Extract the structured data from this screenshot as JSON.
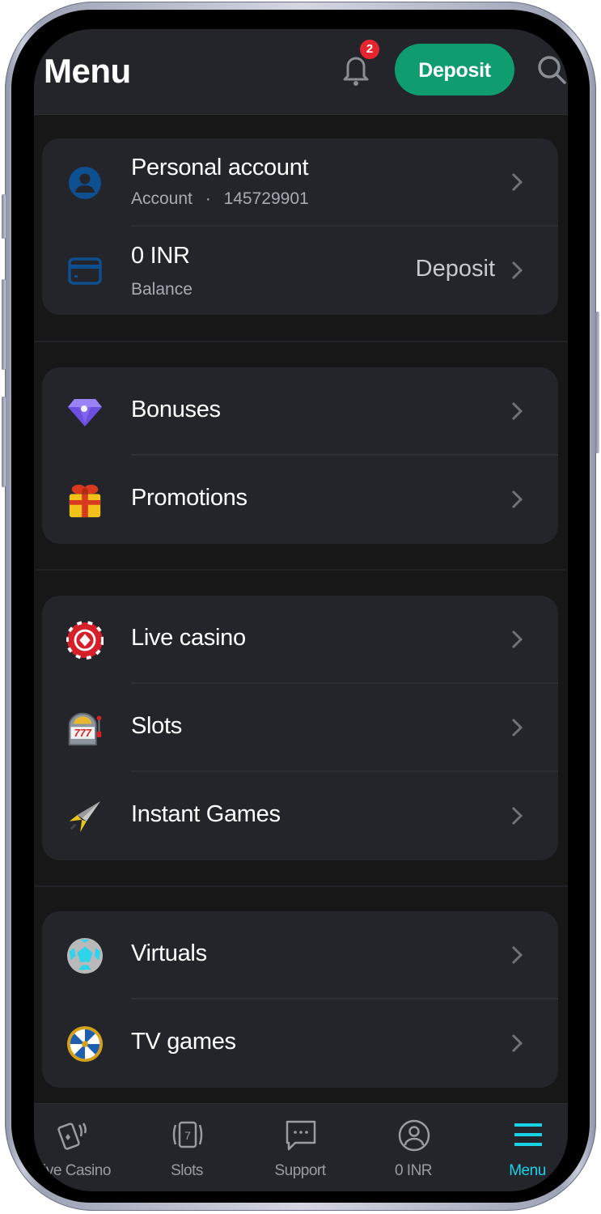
{
  "header": {
    "title": "Menu",
    "notification_count": "2",
    "deposit_label": "Deposit",
    "icons": {
      "notifications": "bell-icon",
      "search": "search-icon"
    }
  },
  "account_card": {
    "personal": {
      "title": "Personal account",
      "sub_label": "Account",
      "separator": "·",
      "account_number": "145729901",
      "icon": "user-circle-icon"
    },
    "balance": {
      "amount": "0 INR",
      "sub_label": "Balance",
      "action_label": "Deposit",
      "icon": "credit-card-icon"
    }
  },
  "sections": [
    {
      "items": [
        {
          "label": "Bonuses",
          "icon": "diamond-icon"
        },
        {
          "label": "Promotions",
          "icon": "gift-icon"
        }
      ]
    },
    {
      "items": [
        {
          "label": "Live casino",
          "icon": "casino-chip-icon"
        },
        {
          "label": "Slots",
          "icon": "slot-machine-icon"
        },
        {
          "label": "Instant Games",
          "icon": "rocket-icon"
        }
      ]
    },
    {
      "items": [
        {
          "label": "Virtuals",
          "icon": "soccer-ball-icon"
        },
        {
          "label": "TV games",
          "icon": "wheel-of-fortune-icon"
        }
      ]
    }
  ],
  "bottom_nav": {
    "items": [
      {
        "label": "Live Casino",
        "icon": "cards-icon",
        "active": false
      },
      {
        "label": "Slots",
        "icon": "slot-7-icon",
        "active": false
      },
      {
        "label": "Support",
        "icon": "chat-icon",
        "active": false
      },
      {
        "label": "0 INR",
        "icon": "profile-icon",
        "active": false
      },
      {
        "label": "Menu",
        "icon": "hamburger-icon",
        "active": true
      }
    ]
  },
  "colors": {
    "accent_green": "#0f9d6f",
    "active_cyan": "#19d2e8",
    "badge_red": "#e5262f",
    "account_icon_blue": "#0e4f8f"
  }
}
